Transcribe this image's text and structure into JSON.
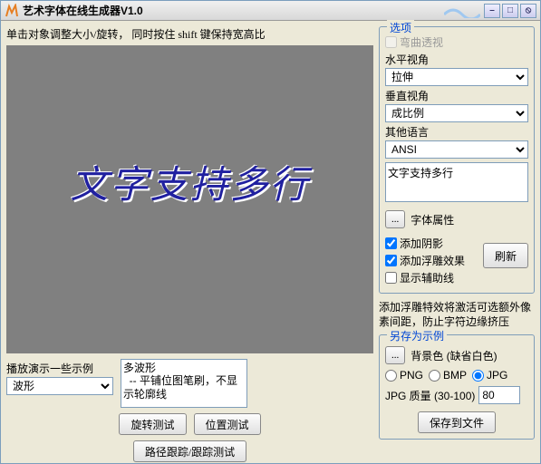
{
  "window": {
    "title": "艺术字体在线生成器V1.0"
  },
  "winbtns": {
    "min": "–",
    "max": "□",
    "close": "⦸"
  },
  "hint": "单击对象调整大小/旋转，  同时按住 shift 键保持宽高比",
  "canvas_text": "文字支持多行",
  "examples": {
    "label": "播放演示一些示例",
    "selected": "波形",
    "desc": "多波形\n  -- 平铺位图笔刷，不显示轮廓线"
  },
  "buttons": {
    "rotate_test": "旋转测试",
    "position_test": "位置测试",
    "path_trace": "路径跟踪/跟踪测试",
    "font_prop": "字体属性",
    "refresh": "刷新",
    "browse": "...",
    "bgcolor": "背景色 (缺省白色)",
    "save": "保存到文件"
  },
  "options": {
    "legend": "选项",
    "bend": "弯曲透视",
    "hview": "水平视角",
    "hview_val": "拉伸",
    "vview": "垂直视角",
    "vview_val": "成比例",
    "lang": "其他语言",
    "lang_val": "ANSI",
    "text_value": "文字支持多行",
    "shadow": "添加阴影",
    "emboss": "添加浮雕效果",
    "guides": "显示辅助线"
  },
  "note": "添加浮雕特效将激活可选额外像素间距，防止字符边缘挤压",
  "save_as": {
    "legend": "另存为示例",
    "png": "PNG",
    "bmp": "BMP",
    "jpg": "JPG",
    "quality_label": "JPG 质量 (30-100)",
    "quality_value": "80"
  }
}
